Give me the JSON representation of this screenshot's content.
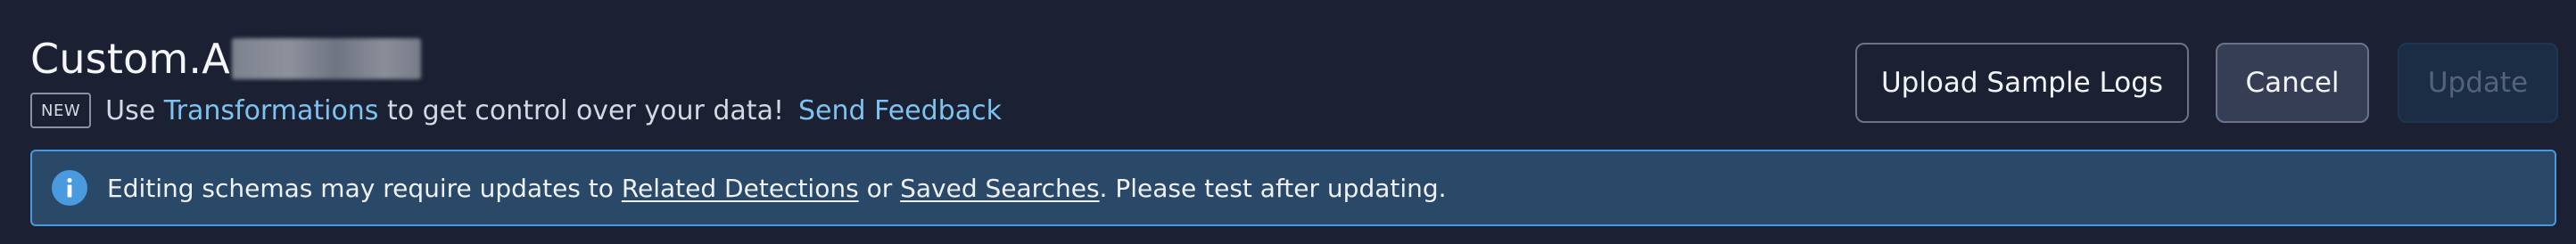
{
  "header": {
    "title_prefix": "Custom.A",
    "badge": "NEW",
    "subtitle_before": "Use ",
    "transformations_link": "Transformations",
    "subtitle_after": " to get control over your data!",
    "send_feedback_link": "Send Feedback"
  },
  "actions": {
    "upload_label": "Upload Sample Logs",
    "cancel_label": "Cancel",
    "update_label": "Update"
  },
  "banner": {
    "icon": "info-icon",
    "text_before": "Editing schemas may require updates to ",
    "related_detections_link": "Related Detections",
    "text_middle": " or ",
    "saved_searches_link": "Saved Searches",
    "text_after": ". Please test after updating."
  },
  "colors": {
    "background": "#1c2033",
    "link": "#7cc3f0",
    "banner_background": "#2a4868",
    "banner_border": "#4a97db",
    "info_icon": "#4a9ae0"
  }
}
